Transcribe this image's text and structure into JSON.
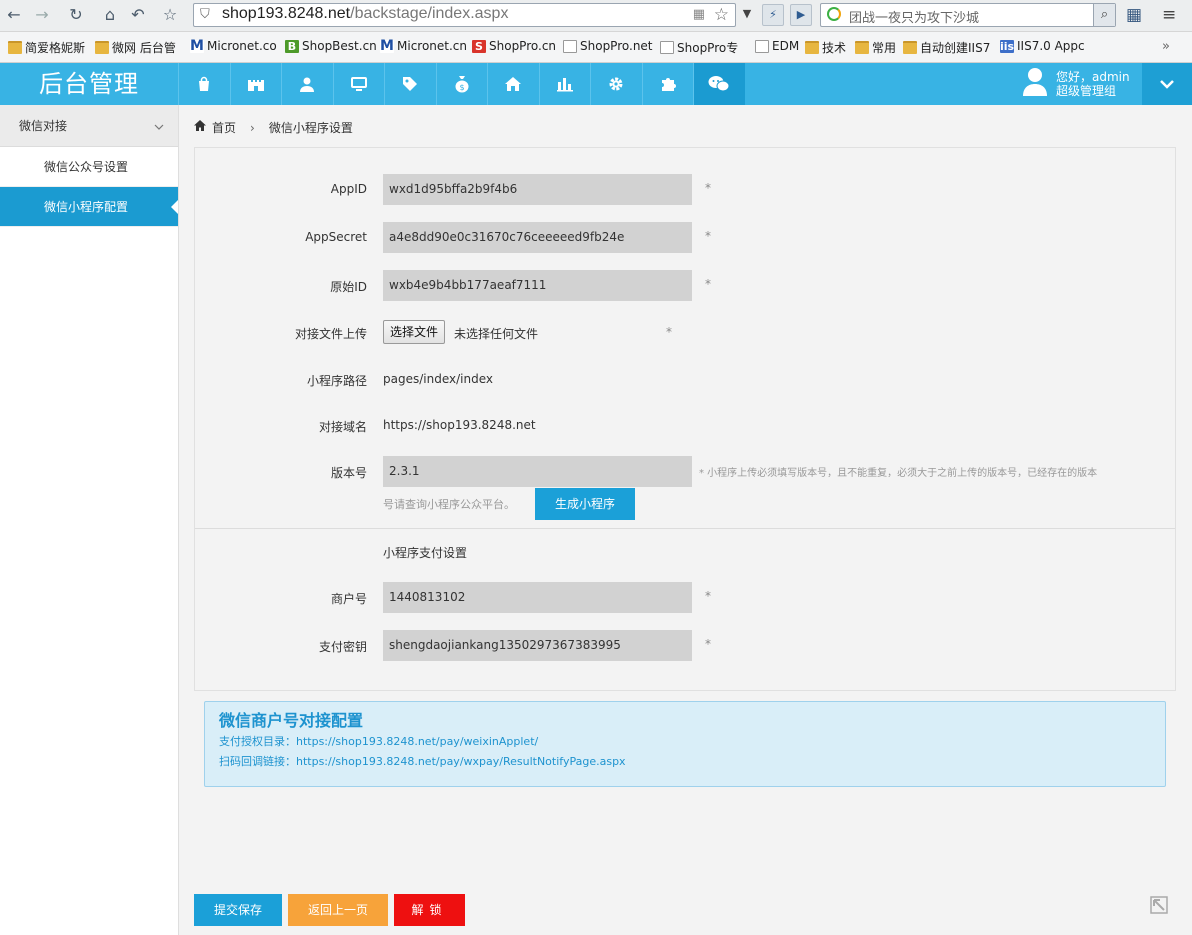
{
  "browser": {
    "url_host": "shop193.8248.net",
    "url_path": "/backstage/index.aspx",
    "search_placeholder": "团战一夜只为攻下沙城",
    "bookmarks": [
      {
        "label": "简爱格妮斯",
        "icon": "folder-icon"
      },
      {
        "label": "微网 后台管",
        "icon": "folder-icon"
      },
      {
        "label": "Micronet.co",
        "icon": "m-logo-icon"
      },
      {
        "label": "ShopBest.cn",
        "icon": "b-logo-icon"
      },
      {
        "label": "Micronet.cn",
        "icon": "m-logo-icon"
      },
      {
        "label": "ShopPro.cn",
        "icon": "s-logo-icon"
      },
      {
        "label": "ShopPro.net",
        "icon": "page-icon"
      },
      {
        "label": "ShopPro专",
        "icon": "page-icon"
      },
      {
        "label": "EDM",
        "icon": "page-icon"
      },
      {
        "label": "技术",
        "icon": "folder-icon"
      },
      {
        "label": "常用",
        "icon": "folder-icon"
      },
      {
        "label": "自动创建IIS7",
        "icon": "folder-icon"
      },
      {
        "label": "IIS7.0 Appc",
        "icon": "iis-icon"
      }
    ],
    "bookmarks_more": "»"
  },
  "header": {
    "title": "后台管理",
    "nav_icons": [
      "bag-icon",
      "castle-icon",
      "user-icon",
      "monitor-icon",
      "tag-icon",
      "money-bag-icon",
      "home-icon",
      "bar-chart-icon",
      "gear-icon",
      "puzzle-icon",
      "wechat-icon"
    ],
    "active_nav": "wechat-icon",
    "greeting": "您好，admin",
    "role": "超级管理组",
    "dropdown_glyph": "⌄"
  },
  "sidebar": {
    "group_label": "微信对接",
    "items": [
      {
        "label": "微信公众号设置",
        "active": false
      },
      {
        "label": "微信小程序配置",
        "active": true
      }
    ]
  },
  "breadcrumb": {
    "home": "首页",
    "current": "微信小程序设置"
  },
  "form": {
    "appid": {
      "label": "AppID",
      "value": "wxd1d95bffa2b9f4b6",
      "required": "*"
    },
    "appsecret": {
      "label": "AppSecret",
      "value": "a4e8dd90e0c31670c76ceeeeed9fb24e",
      "required": "*"
    },
    "original_id": {
      "label": "原始ID",
      "value": "wxb4e9b4bb177aeaf7111",
      "required": "*"
    },
    "file_upload": {
      "label": "对接文件上传",
      "button": "选择文件",
      "status": "未选择任何文件",
      "required": "*"
    },
    "mini_path": {
      "label": "小程序路径",
      "value": "pages/index/index"
    },
    "domain": {
      "label": "对接域名",
      "value": "https://shop193.8248.net"
    },
    "version": {
      "label": "版本号",
      "value": "2.3.1",
      "note": "* 小程序上传必须填写版本号，且不能重复，必须大于之前上传的版本号，已经存在的版本",
      "note2": "号请查询小程序公众平台。",
      "generate_button": "生成小程序"
    },
    "pay_section_title": "小程序支付设置",
    "merchant_id": {
      "label": "商户号",
      "value": "1440813102",
      "required": "*"
    },
    "pay_key": {
      "label": "支付密钥",
      "value": "shengdaojiankang1350297367383995",
      "required": "*"
    }
  },
  "info_box": {
    "title": "微信商户号对接配置",
    "line1": "支付授权目录：https://shop193.8248.net/pay/weixinApplet/",
    "line2": "扫码回调链接：https://shop193.8248.net/pay/wxpay/ResultNotifyPage.aspx"
  },
  "actions": {
    "save": "提交保存",
    "back": "返回上一页",
    "unlock": "解锁"
  },
  "colors": {
    "header_blue": "#38b3e4",
    "active_blue": "#1b9bd1",
    "back_orange": "#f7a33a",
    "unlock_red": "#ee1010"
  }
}
